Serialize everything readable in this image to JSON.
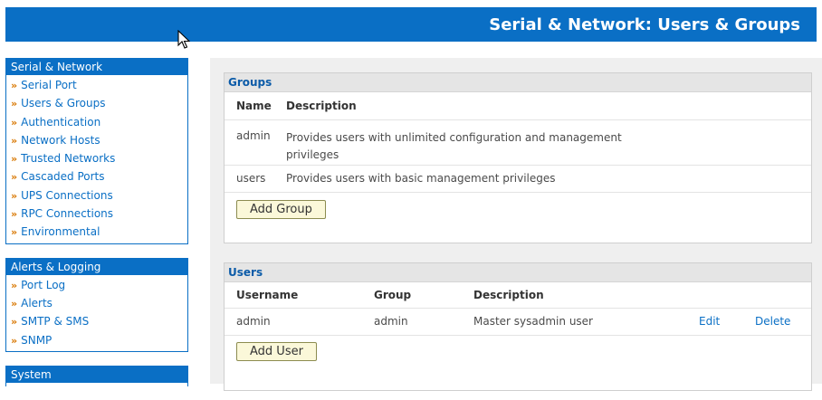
{
  "header": {
    "title": "Serial & Network: Users & Groups"
  },
  "sidebar": {
    "sections": [
      {
        "title": "Serial & Network",
        "items": [
          "Serial Port",
          "Users & Groups",
          "Authentication",
          "Network Hosts",
          "Trusted Networks",
          "Cascaded Ports",
          "UPS Connections",
          "RPC Connections",
          "Environmental"
        ]
      },
      {
        "title": "Alerts & Logging",
        "items": [
          "Port Log",
          "Alerts",
          "SMTP & SMS",
          "SNMP"
        ]
      },
      {
        "title": "System",
        "items": []
      }
    ],
    "bullet": "»"
  },
  "groups": {
    "title": "Groups",
    "columns": [
      "Name",
      "Description"
    ],
    "rows": [
      {
        "name": "admin",
        "description": "Provides users with unlimited configuration and management privileges"
      },
      {
        "name": "users",
        "description": "Provides users with basic management privileges"
      }
    ],
    "add_button": "Add Group"
  },
  "users": {
    "title": "Users",
    "columns": [
      "Username",
      "Group",
      "Description"
    ],
    "rows": [
      {
        "username": "admin",
        "group": "admin",
        "description": "Master sysadmin user",
        "edit": "Edit",
        "delete": "Delete"
      }
    ],
    "add_button": "Add User"
  },
  "colors": {
    "brand_blue": "#0a6fc5",
    "bullet_orange": "#d87700",
    "button_bg": "#fbf8d9"
  }
}
